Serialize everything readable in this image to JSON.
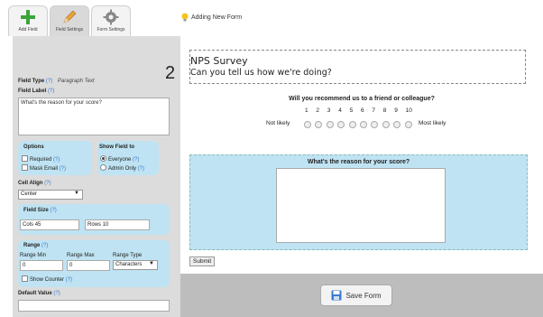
{
  "tabs": [
    {
      "label": "Add Field"
    },
    {
      "label": "Field Settings"
    },
    {
      "label": "Form Settings"
    }
  ],
  "status_text": "Adding New Form",
  "field_number": "2",
  "settings": {
    "field_type_label": "Field Type",
    "field_type_value": "Paragraph Text",
    "field_label_label": "Field Label",
    "field_label_value": "What's the reason for your score?",
    "help": "(?)",
    "options_title": "Options",
    "required_label": "Required",
    "mask_email_label": "Mask Email",
    "show_field_title": "Show Field to",
    "everyone_label": "Everyone",
    "admin_only_label": "Admin Only",
    "cell_align_label": "Cell Align",
    "cell_align_value": "Center",
    "field_size_title": "Field Size",
    "cols_label": "Cols",
    "cols_value": "45",
    "rows_label": "Rows",
    "rows_value": "10",
    "range_title": "Range",
    "range_min_label": "Range Min",
    "range_min_value": "0",
    "range_max_label": "Range Max",
    "range_max_value": "0",
    "range_type_label": "Range Type",
    "range_type_value": "Characters",
    "show_counter_label": "Show Counter",
    "default_value_label": "Default Value"
  },
  "preview": {
    "title": "NPS Survey",
    "subtitle": "Can you tell us how we're doing?",
    "q1": "Will you recommend us to a friend or colleague?",
    "scale": [
      "1",
      "2",
      "3",
      "4",
      "5",
      "6",
      "7",
      "8",
      "9",
      "10"
    ],
    "low_label": "Not likely",
    "high_label": "Most likely",
    "q2": "What's the reason for your score?",
    "submit": "Submit",
    "save": "Save Form"
  }
}
